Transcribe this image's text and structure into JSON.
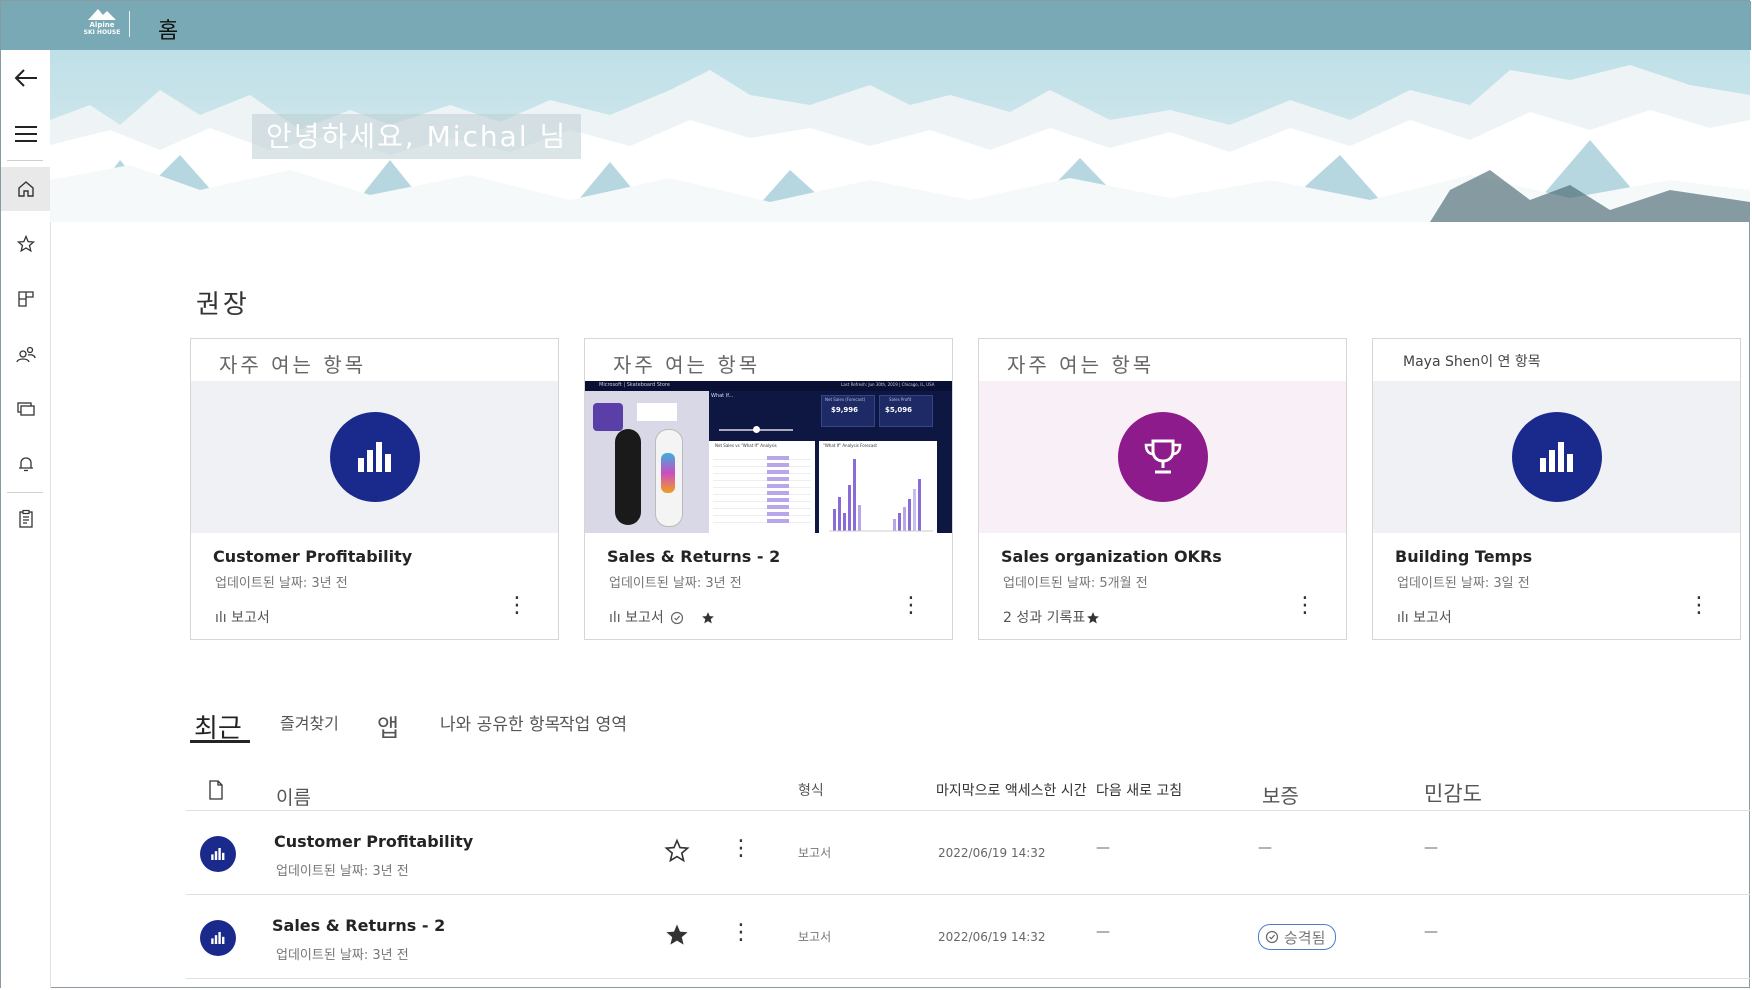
{
  "topbar": {
    "title": "홈",
    "logo_line1": "Alpine",
    "logo_line2": "SKI HOUSE"
  },
  "nav": [
    "back-icon",
    "hamburger-icon",
    "home-icon",
    "star-icon",
    "apps-icon",
    "shared-icon",
    "workspaces-icon",
    "bell-icon",
    "clipboard-icon"
  ],
  "hero": {
    "greeting": "안녕하세요, Michal 님"
  },
  "recommended": {
    "title": "권장",
    "cards": [
      {
        "reason": "자주 여는 항목",
        "name": "Customer Profitability",
        "updated": "업데이트된 날짜: 3년 전",
        "type": "ılı 보고서"
      },
      {
        "reason": "자주 여는 항목",
        "name": "Sales & Returns  - 2",
        "updated": "업데이트된 날짜: 3년 전",
        "type": "ılı 보고서"
      },
      {
        "reason": "자주 여는 항목",
        "name": "Sales organization OKRs",
        "updated": "업데이트된 날짜: 5개월 전",
        "type": "2 성과 기록표"
      },
      {
        "reason": "Maya Shen이 연 항목",
        "name": "Building Temps",
        "updated": "업데이트된 날짜: 3일 전",
        "type": "ılı 보고서"
      }
    ],
    "report_thumb": {
      "brand": "Microsoft | Skateboard Store",
      "refresh": "Last Refresh: Jun 30th, 2019 | Chicago, IL, USA",
      "kpi1_label": "Net Sales (Forecast)",
      "kpi1_value": "$9,996",
      "kpi2_label": "Sales Profit",
      "kpi2_value": "$5,096",
      "table_title": "Net Sales vs \"What If\" Analysis",
      "chart_title": "\"What If\" Analysis Forecast",
      "whatif": "What If..."
    }
  },
  "tabs": {
    "recent": "최근",
    "favorites": "즐겨찾기",
    "apps": "앱",
    "shared": "나와 공유한 항목",
    "workspaces": "작업 영역"
  },
  "list": {
    "headers": {
      "name": "이름",
      "type": "형식",
      "accessed": "마지막으로 액세스한 시간",
      "refresh": "다음 새로 고침",
      "endorsement": "보증",
      "sensitivity": "민감도"
    },
    "rows": [
      {
        "name": "Customer Profitability",
        "updated": "업데이트된 날짜: 3년 전",
        "type": "보고서",
        "accessed": "2022/06/19 14:32",
        "refresh": "—",
        "endorsement": "—",
        "sensitivity": "—",
        "favorite": false
      },
      {
        "name": "Sales & Returns  - 2",
        "updated": "업데이트된 날짜: 3년 전",
        "type": "보고서",
        "accessed": "2022/06/19 14:32",
        "refresh": "—",
        "endorsement": "승격됨",
        "sensitivity": "—",
        "favorite": true
      }
    ]
  },
  "colors": {
    "topbar": "#78a9b5",
    "report_icon": "#1a2a8c",
    "scorecard_icon": "#8e1b8c",
    "badge_border": "#4a7fc6"
  }
}
